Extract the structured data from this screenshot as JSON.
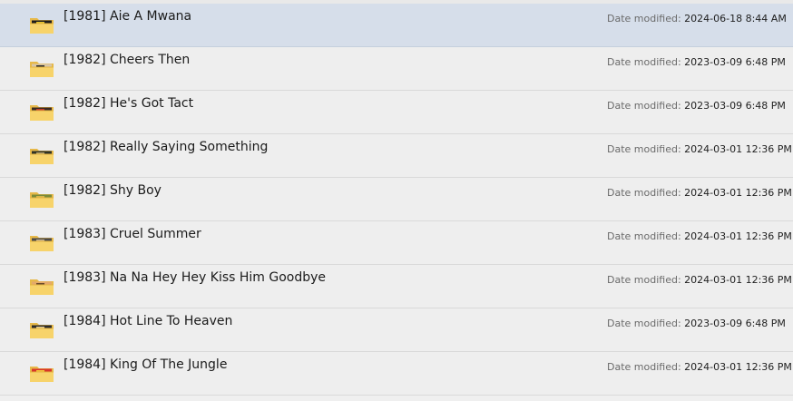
{
  "meta_label": "Date modified:",
  "items": [
    {
      "name": "[1981] Aie A Mwana",
      "modified": "2024-06-18 8:44 AM",
      "selected": true,
      "thumb": {
        "art1": "#1c1c1c",
        "art2": "#e2c12e"
      }
    },
    {
      "name": "[1982] Cheers Then",
      "modified": "2023-03-09 6:48 PM",
      "selected": false,
      "thumb": {
        "art1": "#d8c6a8",
        "art2": "#2a2a2a"
      }
    },
    {
      "name": "[1982] He's Got Tact",
      "modified": "2023-03-09 6:48 PM",
      "selected": false,
      "thumb": {
        "art1": "#3a2a24",
        "art2": "#c0392b"
      }
    },
    {
      "name": "[1982] Really Saying Something",
      "modified": "2024-03-01 12:36 PM",
      "selected": false,
      "thumb": {
        "art1": "#2f3327",
        "art2": "#b7a36a"
      }
    },
    {
      "name": "[1982] Shy Boy",
      "modified": "2024-03-01 12:36 PM",
      "selected": false,
      "thumb": {
        "art1": "#7a8b3a",
        "art2": "#d9b54a"
      }
    },
    {
      "name": "[1983] Cruel Summer",
      "modified": "2024-03-01 12:36 PM",
      "selected": false,
      "thumb": {
        "art1": "#4a4a4a",
        "art2": "#c7b08a"
      }
    },
    {
      "name": "[1983] Na Na Hey Hey Kiss Him Goodbye",
      "modified": "2024-03-01 12:36 PM",
      "selected": false,
      "thumb": {
        "art1": "#e4a96b",
        "art2": "#6b4b2c"
      }
    },
    {
      "name": "[1984] Hot Line To Heaven",
      "modified": "2023-03-09 6:48 PM",
      "selected": false,
      "thumb": {
        "art1": "#2b2b2b",
        "art2": "#e1c98f"
      }
    },
    {
      "name": "[1984] King Of The Jungle",
      "modified": "2024-03-01 12:36 PM",
      "selected": false,
      "thumb": {
        "art1": "#d8352a",
        "art2": "#f3c23b"
      }
    }
  ]
}
